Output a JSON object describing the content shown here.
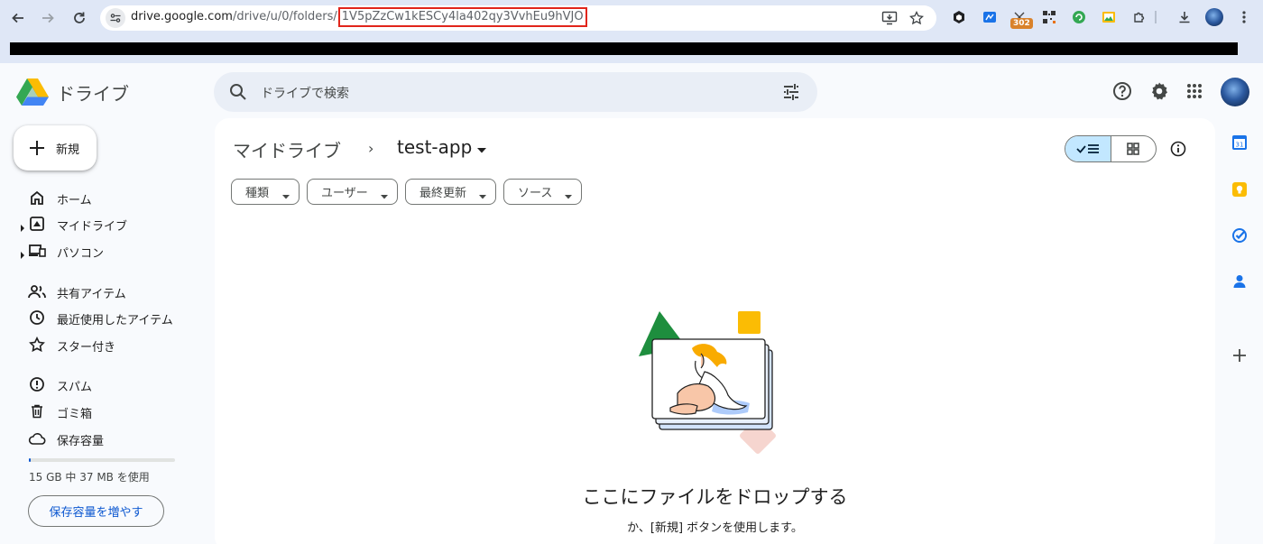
{
  "browser": {
    "url_host": "drive.google.com",
    "url_path": "/drive/u/0/folders/",
    "url_folder_id": "1V5pZzCw1kESCy4la402qy3VvhEu9hVJO",
    "extension_badge": "302",
    "icons": [
      "back-icon",
      "forward-icon",
      "reload-icon",
      "site-info-icon",
      "install-app-icon",
      "star-icon",
      "download-icon",
      "menu-icon"
    ]
  },
  "app": {
    "name": "ドライブ",
    "search_placeholder": "ドライブで検索"
  },
  "sidebar": {
    "new_label": "新規",
    "items": [
      {
        "label": "ホーム",
        "icon": "home-icon"
      },
      {
        "label": "マイドライブ",
        "icon": "my-drive-icon"
      },
      {
        "label": "パソコン",
        "icon": "computers-icon"
      },
      {
        "label": "共有アイテム",
        "icon": "shared-icon"
      },
      {
        "label": "最近使用したアイテム",
        "icon": "recent-icon"
      },
      {
        "label": "スター付き",
        "icon": "star-outline-icon"
      },
      {
        "label": "スパム",
        "icon": "spam-icon"
      },
      {
        "label": "ゴミ箱",
        "icon": "trash-icon"
      },
      {
        "label": "保存容量",
        "icon": "cloud-icon"
      }
    ],
    "storage_used_fraction": 0.003,
    "storage_text": "15 GB 中 37 MB を使用",
    "storage_button": "保存容量を増やす"
  },
  "main": {
    "breadcrumb_root": "マイドライブ",
    "breadcrumb_sep": "›",
    "folder_name": "test-app",
    "filters": [
      "種類",
      "ユーザー",
      "最終更新",
      "ソース"
    ],
    "empty_title": "ここにファイルをドロップする",
    "empty_subtitle": "か、[新規] ボタンを使用します。"
  },
  "side_panel": {
    "calendar_day": "31"
  },
  "colors": {
    "accent": "#0b57d0",
    "selected": "#c2e7ff",
    "url_highlight": "#e1251b"
  }
}
